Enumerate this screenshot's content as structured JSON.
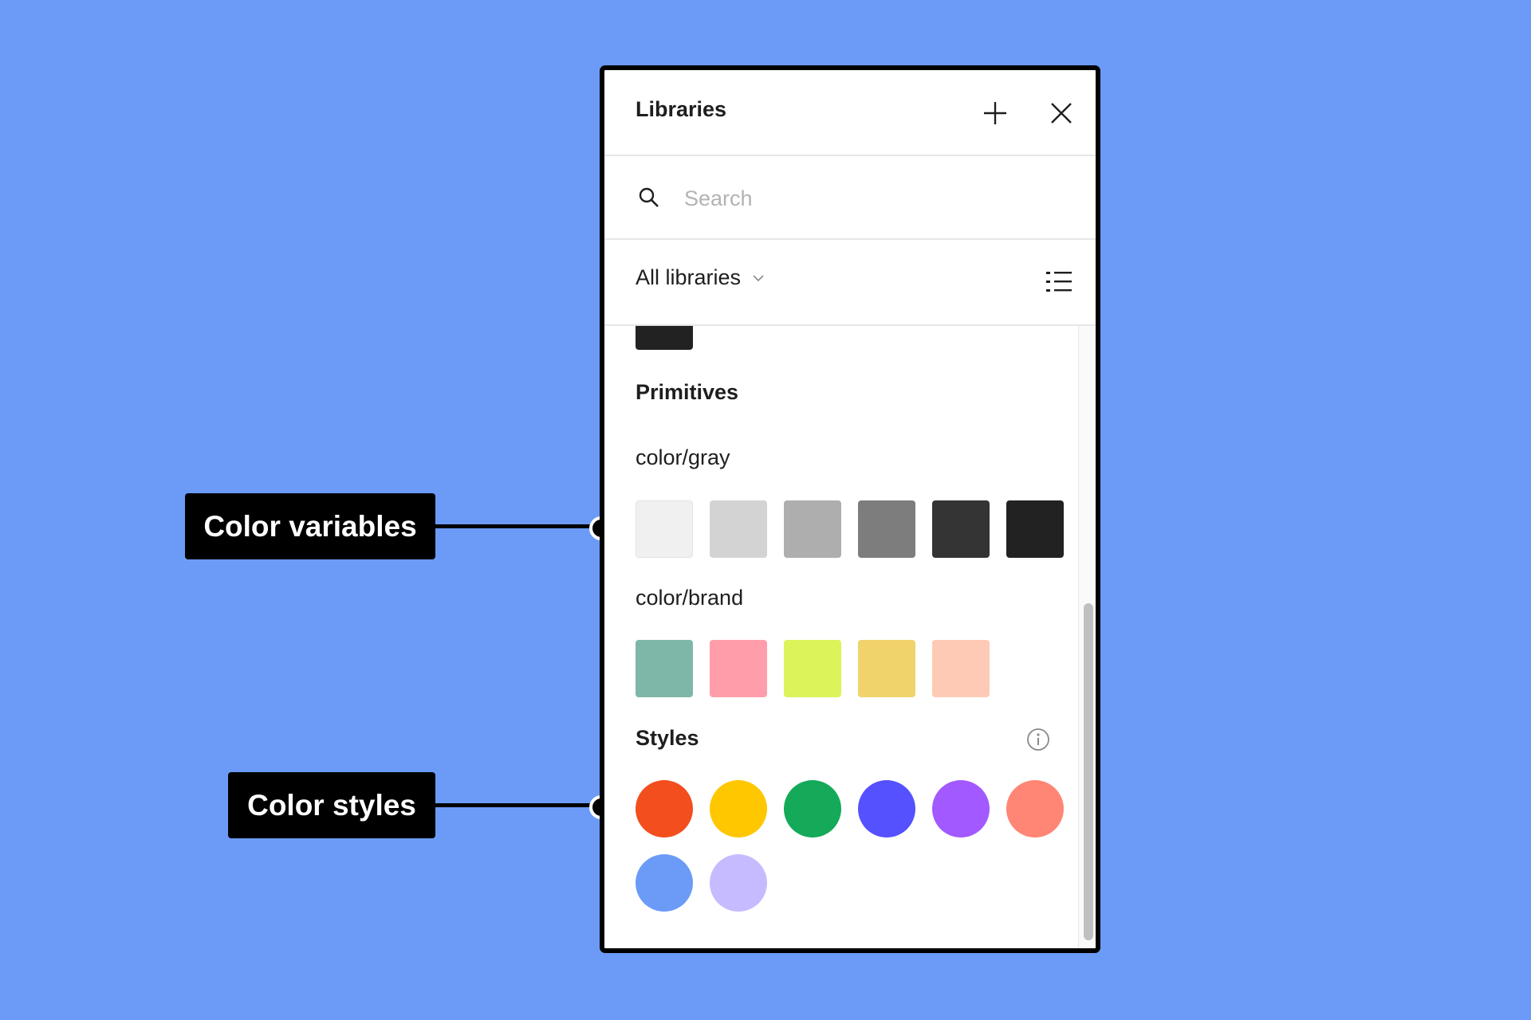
{
  "panel": {
    "title": "Libraries",
    "add_icon": "plus-icon",
    "close_icon": "close-icon",
    "search": {
      "placeholder": "Search",
      "value": "",
      "icon": "search-icon"
    },
    "filter": {
      "label": "All libraries",
      "chevron_icon": "chevron-down-icon",
      "view_toggle_icon": "list-view-icon"
    },
    "partial_swatch_color": "#222222",
    "sections": {
      "primitives": {
        "title": "Primitives",
        "groups": [
          {
            "name": "color/gray",
            "swatches": [
              "#F0F0F0",
              "#D3D3D3",
              "#AEAEAE",
              "#7D7D7D",
              "#343434",
              "#222222"
            ]
          },
          {
            "name": "color/brand",
            "swatches": [
              "#7EB7A8",
              "#FF9EAA",
              "#DDF35A",
              "#F0D36B",
              "#FFCAB5"
            ]
          }
        ]
      },
      "styles": {
        "title": "Styles",
        "info_icon": "info-icon",
        "colors": [
          "#F24E1E",
          "#FFC700",
          "#14AA5A",
          "#5551FF",
          "#A259FF",
          "#FF8575",
          "#6B9BF7",
          "#C7BBFF"
        ]
      }
    },
    "scroll": {
      "position_fraction": 1.0
    }
  },
  "annotations": [
    {
      "label": "Color variables"
    },
    {
      "label": "Color styles"
    }
  ],
  "colors": {
    "background": "#6B9BF7",
    "callout_bg": "#000000",
    "callout_text": "#FFFFFF"
  }
}
